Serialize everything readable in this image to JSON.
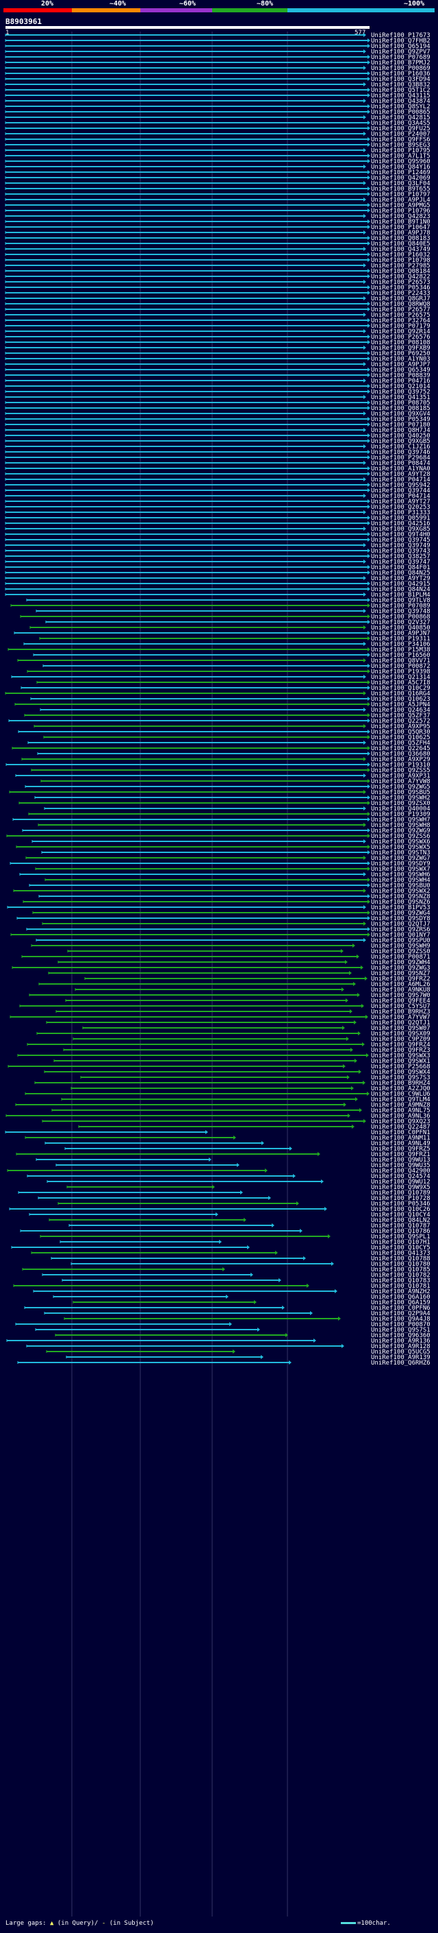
{
  "scale": {
    "ticks": [
      "20%",
      "~40%",
      "~60%",
      "~80%",
      "~100%"
    ],
    "colors": [
      "#ff0000",
      "#ff8800",
      "#9933cc",
      "#22aa22",
      "#22bbdd"
    ]
  },
  "query": {
    "id": "B8903961",
    "start": "1",
    "end": "577"
  },
  "legend": {
    "large_gaps": "Large gaps:",
    "in_query": "(in Query)/",
    "in_subject": "(in Subject)",
    "scale_label": "=100char."
  },
  "hits": [
    "UniRef100_P17673",
    "UniRef100_Q7FHB2",
    "UniRef100_Q65194",
    "UniRef100_Q9ZPV7",
    "UniRef100_P07689",
    "UniRef100_B7PMJ2",
    "UniRef100_P00869",
    "UniRef100_P16036",
    "UniRef100_Q3FD94",
    "UniRef100_Q3B832",
    "UniRef100_Q5T1C2",
    "UniRef100_Q43115",
    "UniRef100_Q43874",
    "UniRef100_Q8SYL2",
    "UniRef100_P00865",
    "UniRef100_Q42815",
    "UniRef100_Q3A4S5",
    "UniRef100_Q9FU25",
    "UniRef100_P24007",
    "UniRef100_Q9FFS6",
    "UniRef100_B9SEG3",
    "UniRef100_P10795",
    "UniRef100_A7L1T5",
    "UniRef100_Q9S960",
    "UniRef100_Q84Y16",
    "UniRef100_P12469",
    "UniRef100_Q42069",
    "UniRef100_Q3LF04",
    "UniRef100_B9T655",
    "UniRef100_P10797",
    "UniRef100_A9PJL4",
    "UniRef100_A9PMG5",
    "UniRef100_P10796",
    "UniRef100_Q42823",
    "UniRef100_B9T1N0",
    "UniRef100_P10647",
    "UniRef100_A9PJ78",
    "UniRef100_Q08183",
    "UniRef100_Q840E5",
    "UniRef100_Q43749",
    "UniRef100_P16032",
    "UniRef100_P10798",
    "UniRef100_P27985",
    "UniRef100_Q08184",
    "UniRef100_Q42822",
    "UniRef100_P26573",
    "UniRef100_P05346",
    "UniRef100_P22433",
    "UniRef100_Q8GRJ7",
    "UniRef100_Q8RWQ8",
    "UniRef100_P26577",
    "UniRef100_P26575",
    "UniRef100_P32764",
    "UniRef100_P07179",
    "UniRef100_Q9ZR14",
    "UniRef100_P26576",
    "UniRef100_P08108",
    "UniRef100_Q9FXB9",
    "UniRef100_P69250",
    "UniRef100_A1YN03",
    "UniRef100_A9PJP7",
    "UniRef100_Q65349",
    "UniRef100_P08839",
    "UniRef100_P04716",
    "UniRef100_Q21014",
    "UniRef100_Q39752",
    "UniRef100_Q41351",
    "UniRef100_P08705",
    "UniRef100_Q08185",
    "UniRef100_Q9XGV4",
    "UniRef100_P05349",
    "UniRef100_P07180",
    "UniRef100_Q8H7J4",
    "UniRef100_Q40250",
    "UniRef100_Q9XGB5",
    "UniRef100_C1JZ16",
    "UniRef100_Q39746",
    "UniRef100_P29684",
    "UniRef100_P08474",
    "UniRef100_A1YNA0",
    "UniRef100_A9YT28",
    "UniRef100_P04714",
    "UniRef100_Q9S942",
    "UniRef100_Q39744",
    "UniRef100_P04714",
    "UniRef100_A9YT27",
    "UniRef100_Q20253",
    "UniRef100_P31333",
    "UniRef100_Q05991",
    "UniRef100_Q42516",
    "UniRef100_Q9XG85",
    "UniRef100_Q9T4H0",
    "UniRef100_Q39745",
    "UniRef100_Q39749",
    "UniRef100_Q39743",
    "UniRef100_Q38257",
    "UniRef100_Q39747",
    "UniRef100_Q84F01",
    "UniRef100_Q84N25",
    "UniRef100_A9YT29",
    "UniRef100_Q42915",
    "UniRef100_Q84N24",
    "UniRef100_B1PLM4",
    "UniRef100_Q9TLV8",
    "UniRef100_P07089",
    "UniRef100_Q39748",
    "UniRef100_P00868",
    "UniRef100_Q2V327",
    "UniRef100_Q40850",
    "UniRef100_A9PJN7",
    "UniRef100_P19311",
    "UniRef100_P34106",
    "UniRef100_P15M38",
    "UniRef100_P16560",
    "UniRef100_Q8VV71",
    "UniRef100_P00872",
    "UniRef100_P19398",
    "UniRef100_Q21314",
    "UniRef100_A5C7I8",
    "UniRef100_Q10C29",
    "UniRef100_Q16RG4",
    "UniRef100_Q10623",
    "UniRef100_A5JPN4",
    "UniRef100_Q24634",
    "UniRef100_Q5ZF37",
    "UniRef100_Q22572",
    "UniRef100_A9XP95",
    "UniRef100_Q5QR30",
    "UniRef100_Q10625",
    "UniRef100_Q5ZFH4",
    "UniRef100_Q22645",
    "UniRef100_Q36680",
    "UniRef100_A9XP29",
    "UniRef100_P19310",
    "UniRef100_Q9ZSS5",
    "UniRef100_A9XP31",
    "UniRef100_A7YVW8",
    "UniRef100_Q9ZWG5",
    "UniRef100_Q9SBU5",
    "UniRef100_Q9SWH2",
    "UniRef100_Q9ZSX0",
    "UniRef100_Q40004",
    "UniRef100_P19309",
    "UniRef100_Q9SWH7",
    "UniRef100_Q9SWH8",
    "UniRef100_Q9ZWG9",
    "UniRef100_Q9ZSS6",
    "UniRef100_Q9SWX6",
    "UniRef100_Q9SWX5",
    "UniRef100_Q9STN3",
    "UniRef100_Q9ZWG7",
    "UniRef100_Q9SDY9",
    "UniRef100_Q9SWX7",
    "UniRef100_Q9SWH6",
    "UniRef100_Q9SWH4",
    "UniRef100_Q9SBU0",
    "UniRef100_Q9SWX2",
    "UniRef100_Q9SNZ8",
    "UniRef100_Q9SNZ6",
    "UniRef100_B1PV53",
    "UniRef100_Q9ZWG4",
    "UniRef100_Q9SDY8",
    "UniRef100_Q2QTJ7",
    "UniRef100_Q9ZRS6",
    "UniRef100_Q01NY7",
    "UniRef100_Q9SPU0",
    "UniRef100_Q9SWH9",
    "UniRef100_Q9ZSS0",
    "UniRef100_P00871",
    "UniRef100_Q9ZWH4",
    "UniRef100_Q9ZWG3",
    "UniRef100_Q9SNZ7",
    "UniRef100_Q9FRZ2",
    "UniRef100_A6ML26",
    "UniRef100_A9NKU8",
    "UniRef100_Q9S7W0",
    "UniRef100_Q9FEE4",
    "UniRef100_C5YSU7",
    "UniRef100_B9RHZ3",
    "UniRef100_A7YVW7",
    "UniRef100_Q2QTJ1",
    "UniRef100_Q9SW07",
    "UniRef100_Q9SX09",
    "UniRef100_C9PZ09",
    "UniRef100_Q9FRZ4",
    "UniRef100_Q9FRZ3",
    "UniRef100_Q9SWX3",
    "UniRef100_Q9SWX1",
    "UniRef100_P25668",
    "UniRef100_Q9SWX4",
    "UniRef100_Q9S7S3",
    "UniRef100_B9RHZ4",
    "UniRef100_A2ZJQ0",
    "UniRef100_C9WLU6",
    "UniRef100_Q9TLM4",
    "UniRef100_A9MNZ8",
    "UniRef100_A9NL75",
    "UniRef100_A9NL36",
    "UniRef100_Q9XQ23",
    "UniRef100_Q22487",
    "UniRef100_C0PFN1",
    "UniRef100_A9NM11",
    "UniRef100_A9NL49",
    "UniRef100_Q9FRZ5",
    "UniRef100_Q9FRZ1",
    "UniRef100_Q9WU13",
    "UniRef100_Q9WU35",
    "UniRef100_Q42900",
    "UniRef100_Q24574",
    "UniRef100_Q9WU12",
    "UniRef100_Q9W9X5",
    "UniRef100_Q10789",
    "UniRef100_P10728",
    "UniRef100_P05346",
    "UniRef100_Q10C26",
    "UniRef100_Q10CY4",
    "UniRef100_Q84LN2",
    "UniRef100_Q10787",
    "UniRef100_Q10786",
    "UniRef100_Q9SPL1",
    "UniRef100_Q107H1",
    "UniRef100_Q10CY5",
    "UniRef100_Q41373",
    "UniRef100_Q10788",
    "UniRef100_Q10780",
    "UniRef100_Q10785",
    "UniRef100_Q10782",
    "UniRef100_Q10783",
    "UniRef100_Q10781",
    "UniRef100_A9NZH2",
    "UniRef100_Q6A160",
    "UniRef100_Q6A159",
    "UniRef100_C0PFN6",
    "UniRef100_Q2P9A4",
    "UniRef100_Q9A4J8",
    "UniRef100_P00870",
    "UniRef100_Q9S7S1",
    "UniRef100_Q96360",
    "UniRef100_A9R136",
    "UniRef100_A9R128",
    "UniRef100_Q5UCG5",
    "UniRef100_A9R139",
    "UniRef100_Q6RHZ6"
  ]
}
